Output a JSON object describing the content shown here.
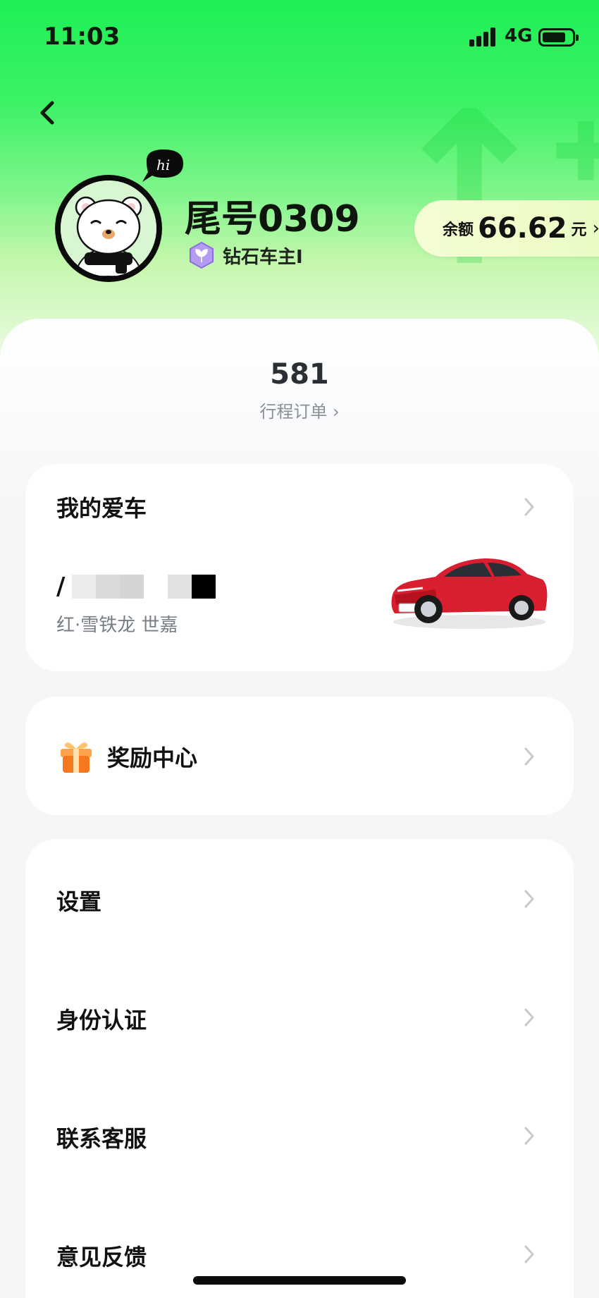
{
  "status_bar": {
    "time": "11:03",
    "network": "4G",
    "battery_level": 0.8
  },
  "profile": {
    "username": "尾号0309",
    "level_badge": "钻石车主I",
    "avatar_bubble": "hi",
    "avatar_icon": "bear-avatar-icon"
  },
  "balance": {
    "label": "余额",
    "value": "66.62",
    "unit": "元"
  },
  "orders": {
    "count": "581",
    "label": "行程订单 ›"
  },
  "my_car": {
    "title": "我的爱车",
    "plate_prefix": "/",
    "plate_masked_shades": [
      "#ebebeb",
      "#dadada",
      "#d4d4d4",
      "#ffffff",
      "#e1e1e1",
      "#000000"
    ],
    "description": "红·雪铁龙 世嘉"
  },
  "reward_center": {
    "title": "奖励中心"
  },
  "menu": {
    "items": [
      {
        "label": "设置"
      },
      {
        "label": "身份认证"
      },
      {
        "label": "联系客服"
      },
      {
        "label": "意见反馈"
      }
    ]
  },
  "colors": {
    "brand_green": "#1ef055",
    "balance_pill": "#f3fdd0",
    "car_red": "#d81e2f",
    "gift_orange": "#f6781e",
    "badge_purple": "#9a7be6"
  }
}
